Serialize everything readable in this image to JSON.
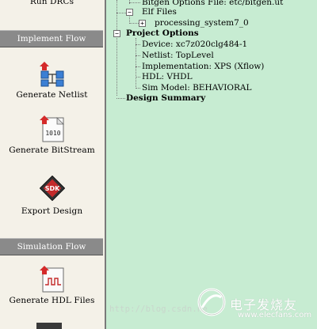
{
  "left_panel": {
    "run_drcs_label": "Run DRCs",
    "implement_flow_header": "Implement Flow",
    "generate_netlist_label": "Generate Netlist",
    "generate_bitstream_label": "Generate BitStream",
    "bitstream_icon_text": "1010",
    "export_design_label": "Export Design",
    "sdk_icon_text": "SDK",
    "simulation_flow_header": "Simulation Flow",
    "generate_hdl_label": "Generate HDL Files"
  },
  "tree": {
    "bitgen_options": "Bitgen Options File: etc/bitgen.ut",
    "elf_files": "Elf Files",
    "processing_system": "processing_system7_0",
    "project_options": "Project Options",
    "device": "Device: xc7z020clg484-1",
    "netlist": "Netlist: TopLevel",
    "implementation": "Implementation: XPS (Xflow)",
    "hdl": "HDL: VHDL",
    "sim_model": "Sim Model: BEHAVIORAL",
    "design_summary": "Design Summary"
  },
  "watermark": {
    "url": "http://blog.csdn.ne",
    "brand": "电子发烧友",
    "site": "www.elecfans.com"
  }
}
